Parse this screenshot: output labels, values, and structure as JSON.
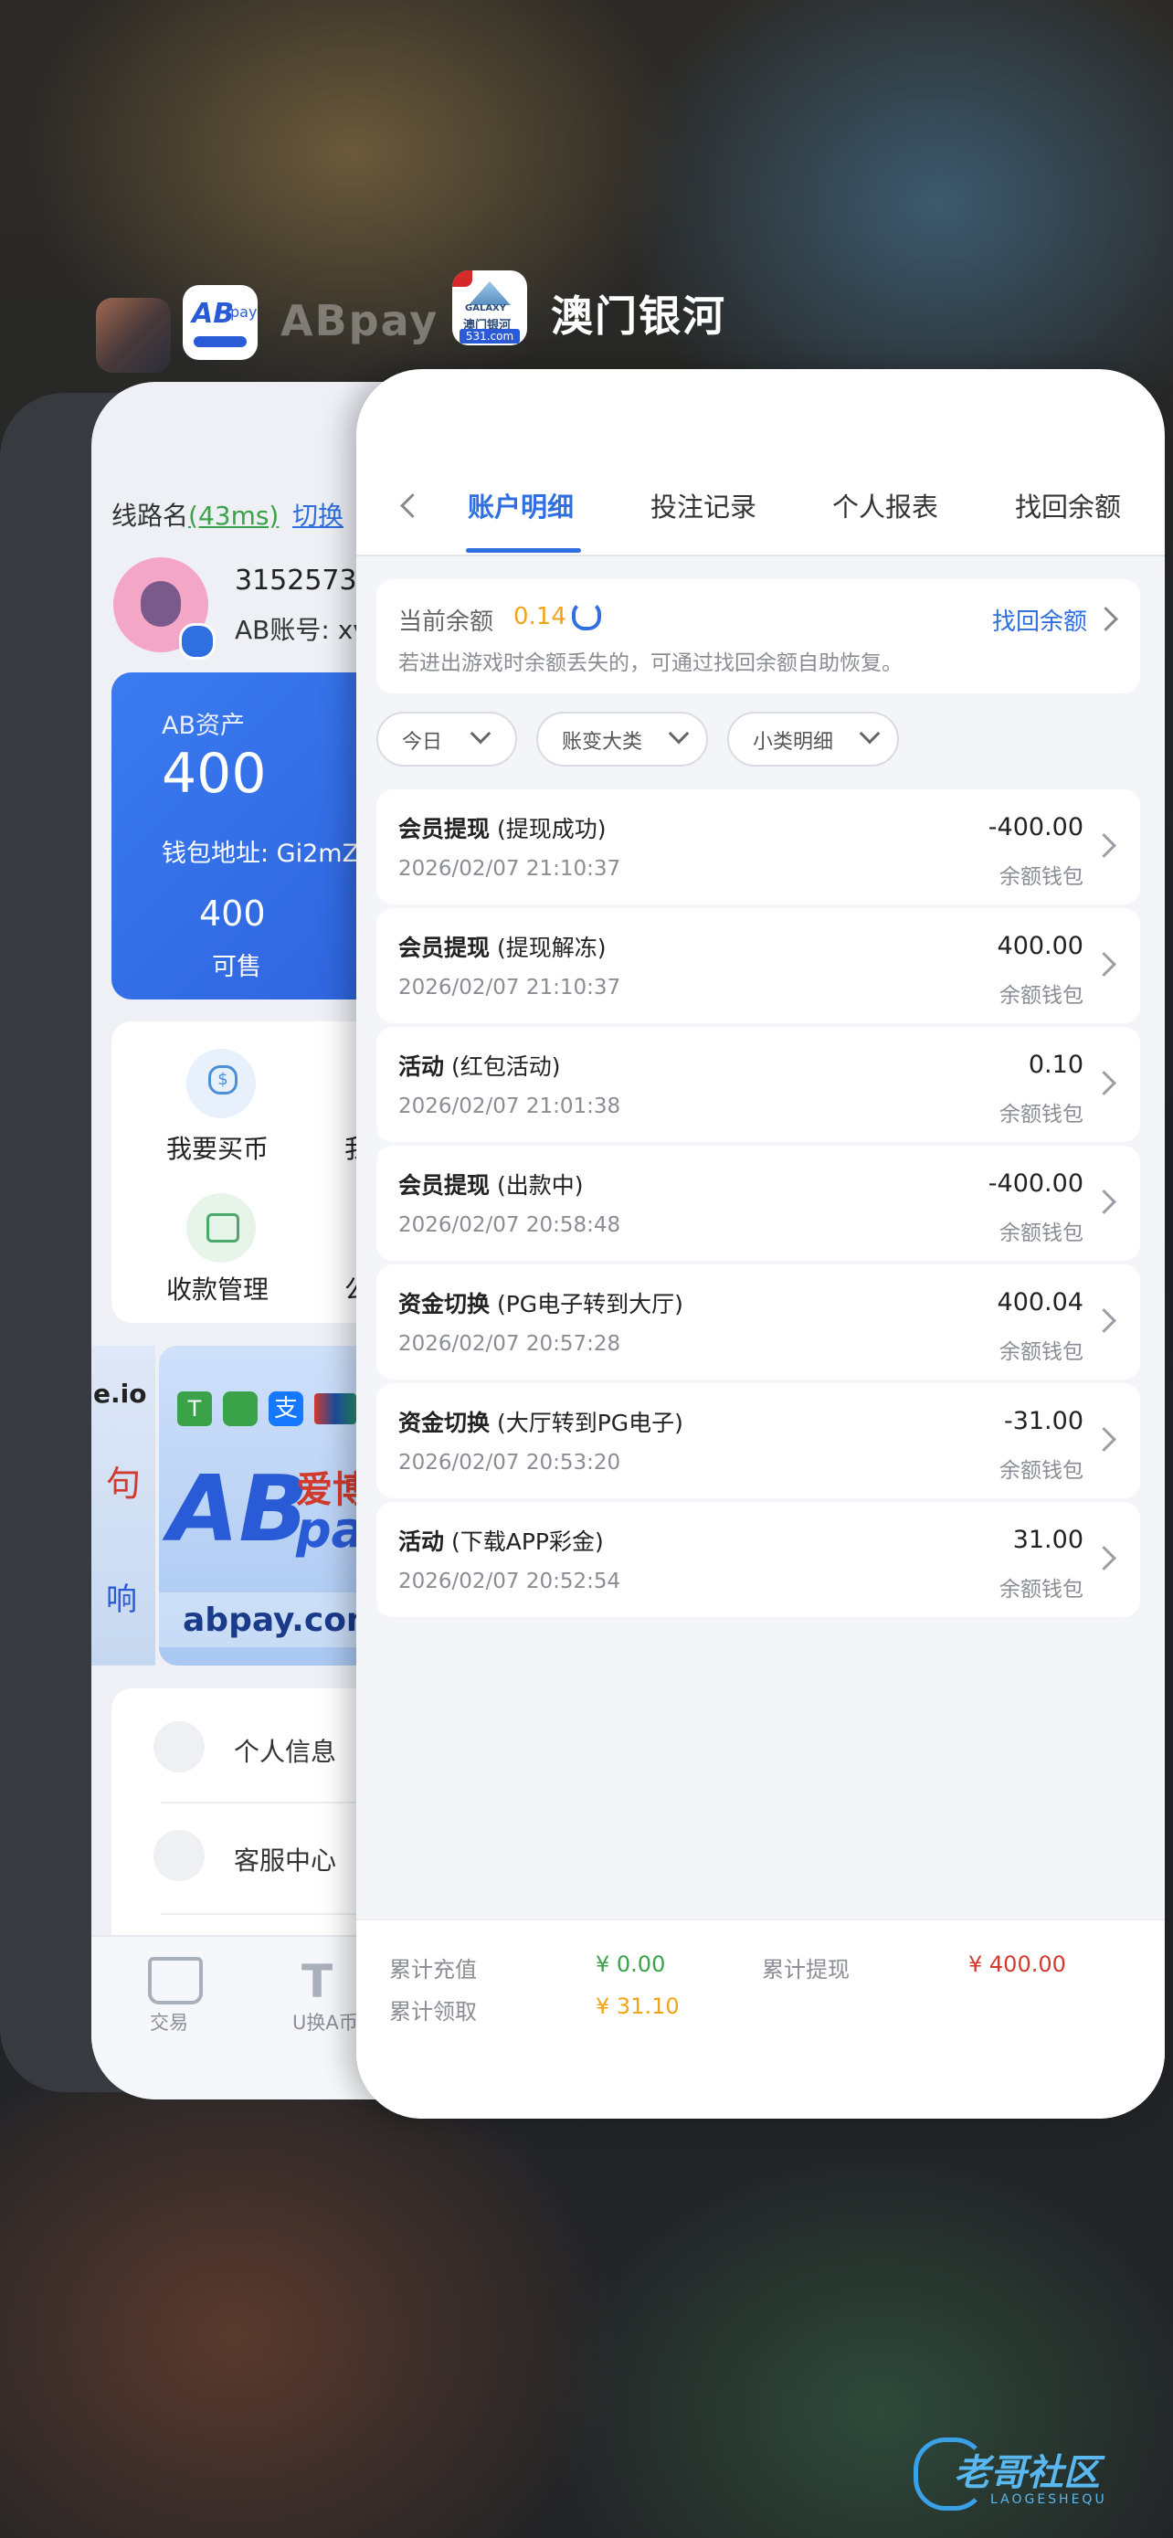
{
  "app_switcher": {
    "abpay_label": "ABpay",
    "main_app_label": "澳门银河",
    "galaxy_icon_text": "GALAXY",
    "galaxy_icon_cn": "澳门银河",
    "galaxy_icon_domain": "531.com",
    "abpay_icon_text": "AB",
    "abpay_icon_sub": "pay"
  },
  "abpay": {
    "line_label": "线路名",
    "latency": "(43ms)",
    "switch": "切换",
    "user_id": "3152573",
    "account_label": "AB账号: xv",
    "asset_label": "AB资产",
    "asset_value": "400",
    "wallet_label": "钱包地址: Gi2mZ",
    "sellable_value": "400",
    "sellable_label": "可售",
    "buy_coin": "我要买币",
    "buy_coin_cut": "我",
    "payment_mgmt": "收款管理",
    "payment_cut": "公",
    "banner_left_1": "e.io",
    "banner_left_2": "句",
    "banner_left_3": "响",
    "banner_url": "abpay.com",
    "banner_brand": "爱博",
    "banner_pay": "pay",
    "personal_info": "个人信息",
    "service_center": "客服中心",
    "nav_trade": "交易",
    "nav_exchange": "U换A币"
  },
  "main": {
    "tabs": [
      "账户明细",
      "投注记录",
      "个人报表",
      "找回余额"
    ],
    "balance_label": "当前余额",
    "balance_value": "0.14",
    "recover_link": "找回余额",
    "balance_tip": "若进出游戏时余额丢失的，可通过找回余额自助恢复。",
    "filters": [
      "今日",
      "账变大类",
      "小类明细"
    ],
    "records": [
      {
        "title": "会员提现",
        "sub": " (提现成功)",
        "date": "2026/02/07 21:10:37",
        "amount": "-400.00",
        "wallet": "余额钱包"
      },
      {
        "title": "会员提现",
        "sub": " (提现解冻)",
        "date": "2026/02/07 21:10:37",
        "amount": "400.00",
        "wallet": "余额钱包"
      },
      {
        "title": "活动",
        "sub": " (红包活动)",
        "date": "2026/02/07 21:01:38",
        "amount": "0.10",
        "wallet": "余额钱包"
      },
      {
        "title": "会员提现",
        "sub": " (出款中)",
        "date": "2026/02/07 20:58:48",
        "amount": "-400.00",
        "wallet": "余额钱包"
      },
      {
        "title": "资金切换",
        "sub": " (PG电子转到大厅)",
        "date": "2026/02/07 20:57:28",
        "amount": "400.04",
        "wallet": "余额钱包"
      },
      {
        "title": "资金切换",
        "sub": " (大厅转到PG电子)",
        "date": "2026/02/07 20:53:20",
        "amount": "-31.00",
        "wallet": "余额钱包"
      },
      {
        "title": "活动",
        "sub": " (下载APP彩金)",
        "date": "2026/02/07 20:52:54",
        "amount": "31.00",
        "wallet": "余额钱包"
      }
    ],
    "footer": {
      "recharge_label": "累计充值",
      "recharge_value": "¥ 0.00",
      "withdraw_label": "累计提现",
      "withdraw_value": "¥ 400.00",
      "claim_label": "累计领取",
      "claim_value": "¥ 31.10"
    }
  },
  "watermark": {
    "cn": "老哥社区",
    "en": "LAOGESHEQU"
  },
  "colors": {
    "accent": "#2f6fe0",
    "green": "#3aa34a",
    "red": "#d23a2e",
    "gold": "#f0a418"
  }
}
